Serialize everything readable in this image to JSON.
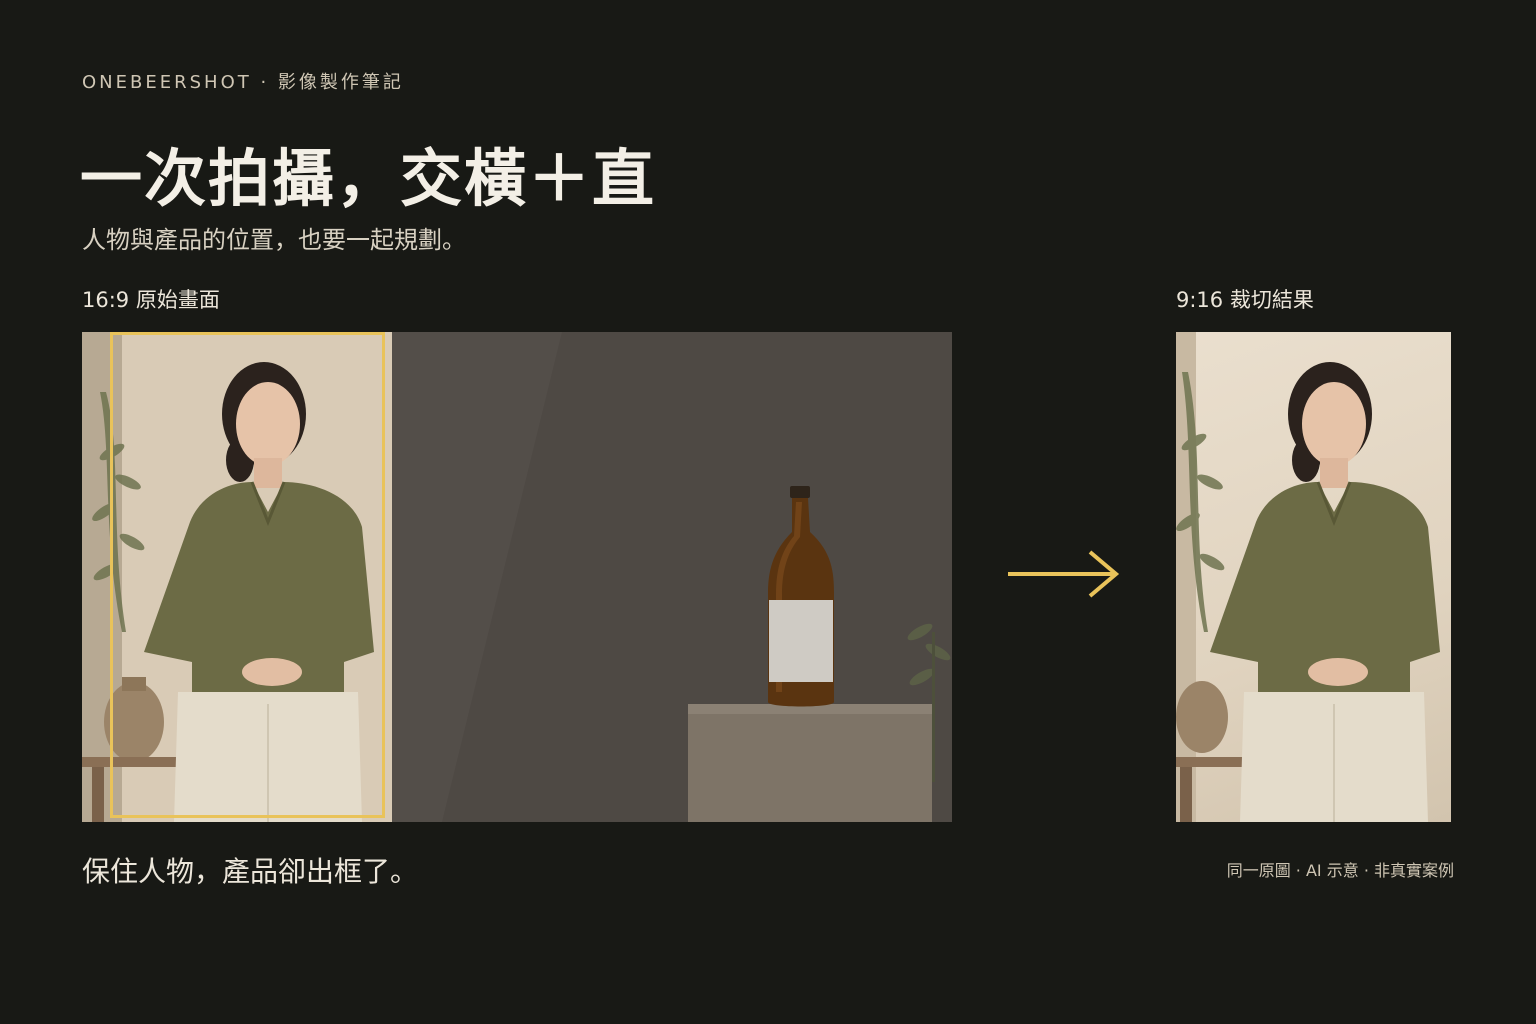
{
  "header": {
    "eyebrow": "ONEBEERSHOT · 影像製作筆記",
    "title": "一次拍攝，交橫＋直",
    "subtitle": "人物與產品的位置，也要一起規劃。"
  },
  "left_panel": {
    "label": "16:9 原始畫面",
    "caption": "保住人物，產品卻出框了。"
  },
  "right_panel": {
    "label": "9:16 裁切結果",
    "note": "同一原圖 · AI 示意 · 非真實案例"
  },
  "colors": {
    "background": "#181915",
    "accent": "#e9c35a",
    "text": "#ece6da"
  },
  "icons": {
    "arrow": "arrow-right-icon"
  }
}
